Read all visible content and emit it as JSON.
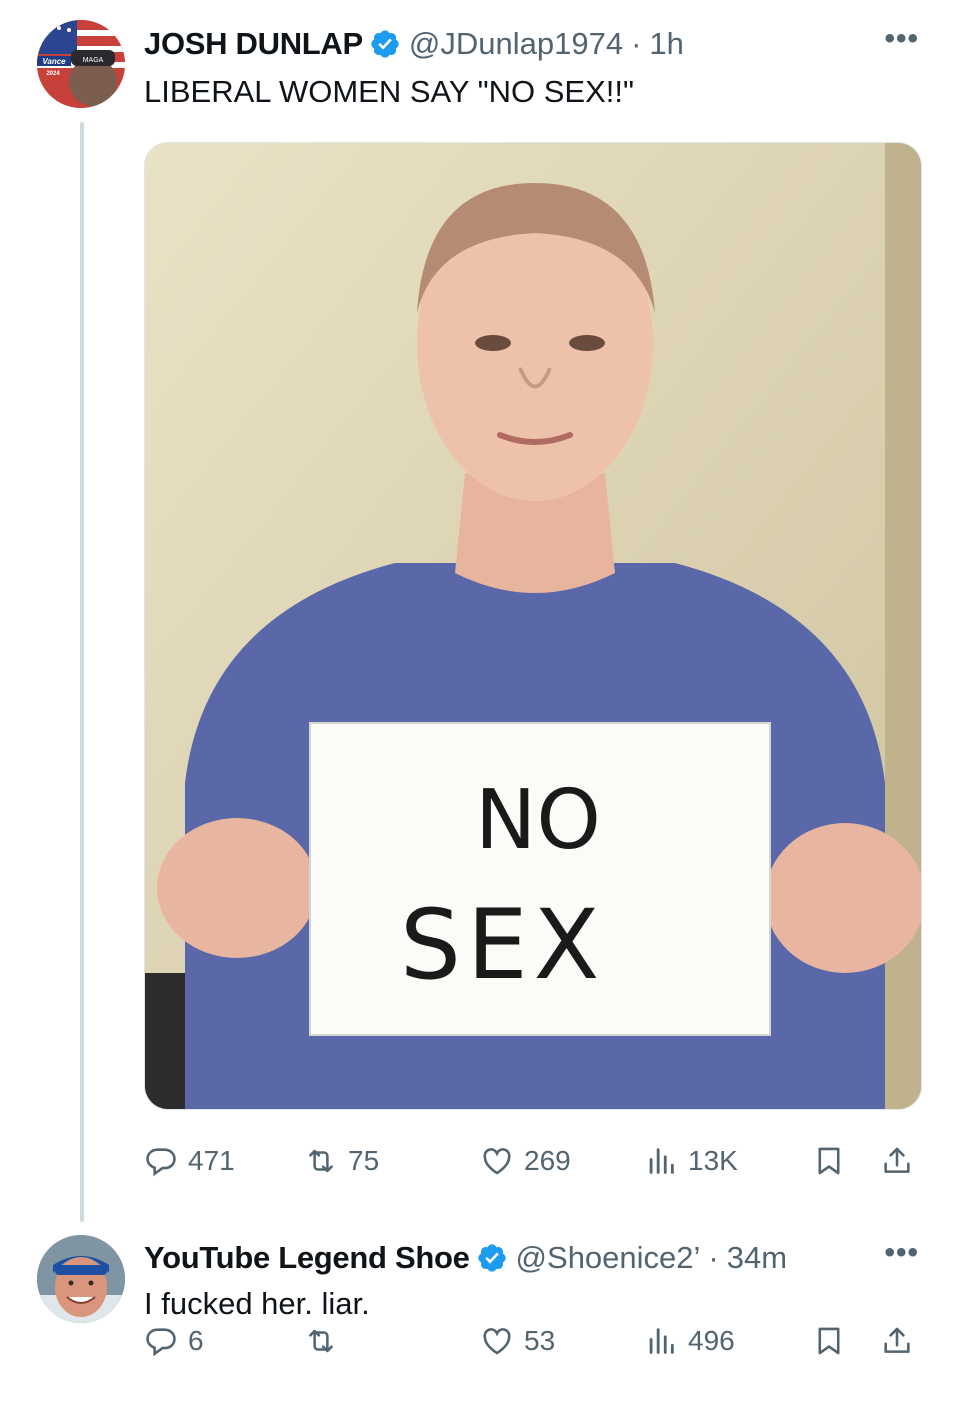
{
  "thread": [
    {
      "author": {
        "name": "JOSH DUNLAP",
        "handle": "@JDunlap1974",
        "time": "1h",
        "avatar_text": [
          "Vance",
          "MAGA",
          "2024"
        ]
      },
      "text": "LIBERAL WOMEN SAY \"NO SEX!!\"",
      "media": {
        "sign_text": [
          "NO",
          "SEX"
        ]
      },
      "actions": {
        "replies": "471",
        "reposts": "75",
        "likes": "269",
        "views": "13K"
      }
    },
    {
      "author": {
        "name": "YouTube Legend Shoe",
        "handle": "@Shoenice2’",
        "time": "34m"
      },
      "text": "I fucked her. liar.",
      "actions": {
        "replies": "6",
        "reposts": "",
        "likes": "53",
        "views": "496"
      }
    }
  ],
  "separator": "·",
  "more_glyph": "•••",
  "colors": {
    "verified": "#1d9bf0",
    "secondary_text": "#536471",
    "thread_line": "#cfd9de"
  },
  "icons": [
    "verified-badge-icon",
    "more-icon",
    "reply-icon",
    "repost-icon",
    "like-icon",
    "views-icon",
    "bookmark-icon",
    "share-icon"
  ]
}
